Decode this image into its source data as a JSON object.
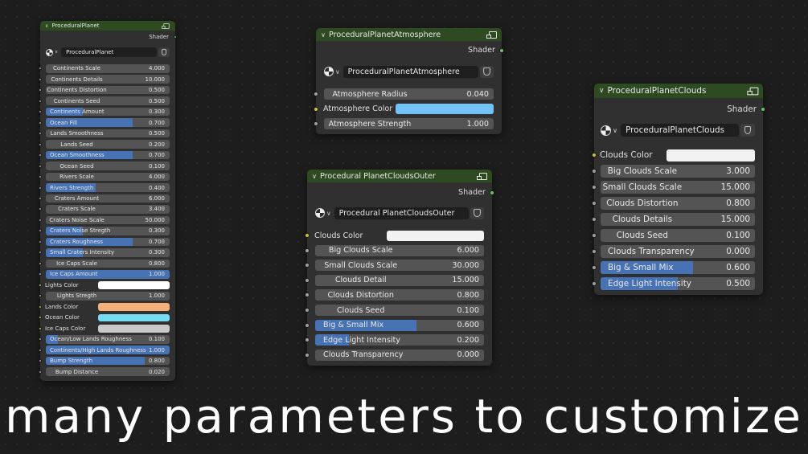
{
  "colors": {
    "header": "#2e4a21",
    "slider_fill": "#4772b3",
    "field_bg": "#545454",
    "socket_green": "#63c763",
    "socket_gray": "#a1a1a1",
    "socket_yellow": "#c7c729"
  },
  "caption": "many parameters to customize",
  "nodes": [
    {
      "title": "ProceduralPlanet",
      "output": "Shader",
      "group": "ProceduralPlanet",
      "params": [
        {
          "type": "value",
          "label": "Continents Scale",
          "value": "4.000",
          "fill": 0
        },
        {
          "type": "value",
          "label": "Continents Details",
          "value": "10.000",
          "fill": 0
        },
        {
          "type": "value",
          "label": "Continents Distortion",
          "value": "0.500",
          "fill": 0
        },
        {
          "type": "value",
          "label": "Continents Seed",
          "value": "0.500",
          "fill": 0
        },
        {
          "type": "value",
          "label": "Continents Amount",
          "value": "0.300",
          "fill": 0.3
        },
        {
          "type": "value",
          "label": "Ocean Fill",
          "value": "0.700",
          "fill": 0.7
        },
        {
          "type": "value",
          "label": "Lands Smoothness",
          "value": "0.500",
          "fill": 0
        },
        {
          "type": "value",
          "label": "Lands Seed",
          "value": "0.200",
          "fill": 0
        },
        {
          "type": "value",
          "label": "Ocean Smoothness",
          "value": "0.700",
          "fill": 0.7
        },
        {
          "type": "value",
          "label": "Ocean Seed",
          "value": "0.100",
          "fill": 0
        },
        {
          "type": "value",
          "label": "Rivers Scale",
          "value": "4.000",
          "fill": 0
        },
        {
          "type": "value",
          "label": "Rivers Strength",
          "value": "0.400",
          "fill": 0.4
        },
        {
          "type": "value",
          "label": "Craters Amount",
          "value": "6.000",
          "fill": 0
        },
        {
          "type": "value",
          "label": "Craters Scale",
          "value": "3.400",
          "fill": 0
        },
        {
          "type": "value",
          "label": "Craters Noise Scale",
          "value": "50.000",
          "fill": 0
        },
        {
          "type": "value",
          "label": "Craters Noise Stregth",
          "value": "0.300",
          "fill": 0.3
        },
        {
          "type": "value",
          "label": "Craters Roughness",
          "value": "0.700",
          "fill": 0.7
        },
        {
          "type": "value",
          "label": "Small Craters Intensity",
          "value": "0.300",
          "fill": 0.3
        },
        {
          "type": "value",
          "label": "Ice Caps  Scale",
          "value": "0.800",
          "fill": 0
        },
        {
          "type": "value",
          "label": "Ice Caps Amount",
          "value": "1.000",
          "fill": 1
        },
        {
          "type": "color",
          "label": "Lights Color",
          "color": "#ffffff"
        },
        {
          "type": "value",
          "label": "Lights Stregth",
          "value": "1.000",
          "fill": 0
        },
        {
          "type": "color",
          "label": "Lands Color",
          "color": "#f4b07a"
        },
        {
          "type": "color",
          "label": "Ocean Color",
          "color": "#74dcf4"
        },
        {
          "type": "color",
          "label": "Ice Caps Color",
          "color": "#c9c9c9"
        },
        {
          "type": "value",
          "label": "Ocean/Low Lands Roughness",
          "value": "0.100",
          "fill": 0.1
        },
        {
          "type": "value",
          "label": "Continents/High Lands Roughness",
          "value": "1.000",
          "fill": 1
        },
        {
          "type": "value",
          "label": "Bump Strength",
          "value": "0.800",
          "fill": 0.8
        },
        {
          "type": "value",
          "label": "Bump Distance",
          "value": "0.020",
          "fill": 0
        }
      ]
    },
    {
      "title": "ProceduralPlanetAtmosphere",
      "output": "Shader",
      "group": "ProceduralPlanetAtmosphere",
      "params": [
        {
          "type": "value",
          "label": "Atmosphere Radius",
          "value": "0.040",
          "fill": 0
        },
        {
          "type": "color",
          "label": "Atmosphere Color",
          "color": "#72c2f8"
        },
        {
          "type": "value",
          "label": "Atmosphere Strength",
          "value": "1.000",
          "fill": 0
        }
      ]
    },
    {
      "title": "Procedural PlanetCloudsOuter",
      "output": "Shader",
      "group": "Procedural PlanetCloudsOuter",
      "params": [
        {
          "type": "color",
          "label": "Clouds Color",
          "color": "#f2f2f2"
        },
        {
          "type": "value",
          "label": "Big Clouds Scale",
          "value": "6.000",
          "fill": 0
        },
        {
          "type": "value",
          "label": "Small Clouds Scale",
          "value": "30.000",
          "fill": 0
        },
        {
          "type": "value",
          "label": "Clouds Detail",
          "value": "15.000",
          "fill": 0
        },
        {
          "type": "value",
          "label": "Clouds Distortion",
          "value": "0.800",
          "fill": 0
        },
        {
          "type": "value",
          "label": "Clouds Seed",
          "value": "0.100",
          "fill": 0
        },
        {
          "type": "value",
          "label": "Big & Small Mix",
          "value": "0.600",
          "fill": 0.6
        },
        {
          "type": "value",
          "label": "Edge Light Intensity",
          "value": "0.200",
          "fill": 0.2
        },
        {
          "type": "value",
          "label": "Clouds Transparency",
          "value": "0.000",
          "fill": 0
        }
      ]
    },
    {
      "title": "ProceduralPlanetClouds",
      "output": "Shader",
      "group": "ProceduralPlanetClouds",
      "params": [
        {
          "type": "color",
          "label": "Clouds Color",
          "color": "#f2f2f2"
        },
        {
          "type": "value",
          "label": "Big Clouds Scale",
          "value": "3.000",
          "fill": 0
        },
        {
          "type": "value",
          "label": "Small Clouds Scale",
          "value": "15.000",
          "fill": 0
        },
        {
          "type": "value",
          "label": "Clouds Distortion",
          "value": "0.800",
          "fill": 0
        },
        {
          "type": "value",
          "label": "Clouds Details",
          "value": "15.000",
          "fill": 0
        },
        {
          "type": "value",
          "label": "Clouds Seed",
          "value": "0.100",
          "fill": 0
        },
        {
          "type": "value",
          "label": "Clouds Transparency",
          "value": "0.000",
          "fill": 0
        },
        {
          "type": "value",
          "label": "Big & Small Mix",
          "value": "0.600",
          "fill": 0.6
        },
        {
          "type": "value",
          "label": "Edge Light Intensity",
          "value": "0.500",
          "fill": 0.5
        }
      ]
    }
  ]
}
